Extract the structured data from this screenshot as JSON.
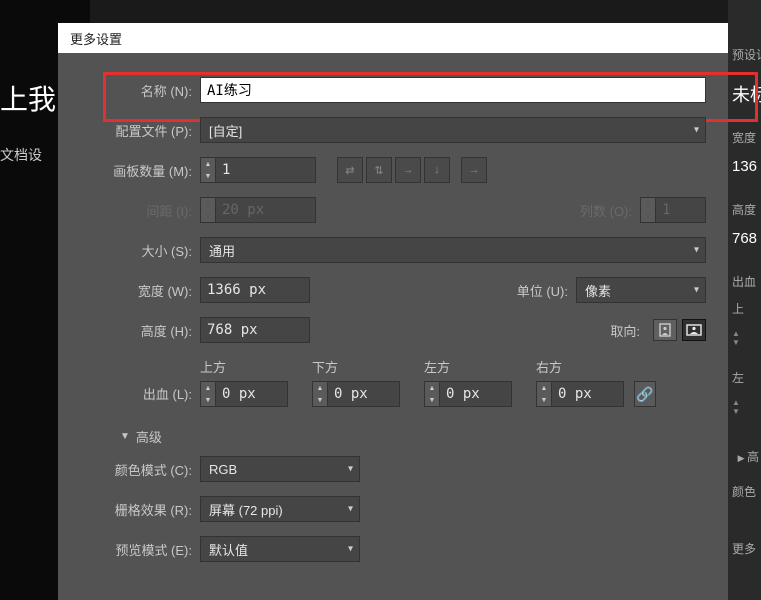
{
  "dialog": {
    "title": "更多设置",
    "name_label": "名称 (N):",
    "name_value": "AI练习",
    "profile_label": "配置文件 (P):",
    "profile_value": "[自定]",
    "artboards_label": "画板数量 (M):",
    "artboards_value": "1",
    "spacing_label": "间距 (I):",
    "spacing_value": "20 px",
    "columns_label": "列数 (O):",
    "columns_value": "1",
    "size_label": "大小 (S):",
    "size_value": "通用",
    "width_label": "宽度 (W):",
    "width_value": "1366 px",
    "units_label": "单位 (U):",
    "units_value": "像素",
    "height_label": "高度 (H):",
    "height_value": "768 px",
    "orientation_label": "取向:",
    "bleed_label": "出血 (L):",
    "bleed_top_label": "上方",
    "bleed_bottom_label": "下方",
    "bleed_left_label": "左方",
    "bleed_right_label": "右方",
    "bleed_top": "0 px",
    "bleed_bottom": "0 px",
    "bleed_left": "0 px",
    "bleed_right": "0 px",
    "advanced_label": "高级",
    "color_mode_label": "颜色模式 (C):",
    "color_mode_value": "RGB",
    "raster_label": "栅格效果 (R):",
    "raster_value": "屏幕 (72 ppi)",
    "preview_label": "预览模式 (E):",
    "preview_value": "默认值"
  },
  "bg": {
    "left_title": "上我",
    "left_sub": "文档设",
    "r_preset": "预设记",
    "r_untitled": "未标",
    "r_width_label": "宽度",
    "r_width_val": "136",
    "r_height_label": "高度",
    "r_height_val": "768",
    "r_bleed_label": "出血",
    "r_top": "上",
    "r_left": "左",
    "r_adv": "高",
    "r_color": "颜色",
    "r_more": "更多"
  }
}
